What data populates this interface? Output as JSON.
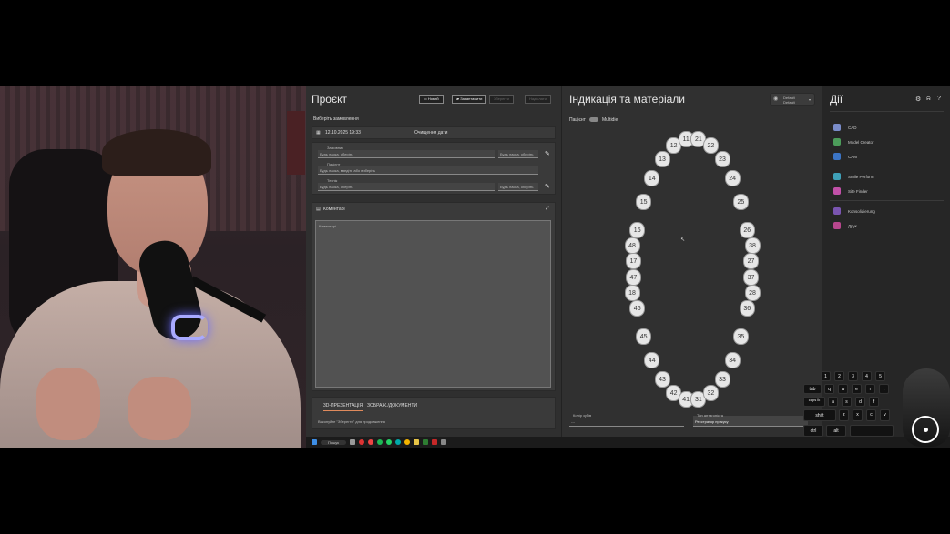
{
  "project": {
    "title": "Проєкт",
    "buttons": [
      "Новий",
      "Завантажити",
      "Зберегти",
      "Надіслати"
    ],
    "select_case": "Виберіть замовлення",
    "date": "12.10.2025 19:33",
    "clear_data": "Очищення дати",
    "fields": [
      {
        "label": "Замовник",
        "value": "Будь ласка, оберіть"
      },
      {
        "label": "Пацієнт",
        "value": "Будь ласка, введіть або виберіть"
      },
      {
        "label": "Технік",
        "value": "Будь ласка, оберіть"
      }
    ],
    "side_fields": [
      "Будь ласка, оберіть",
      "Будь ласка, оберіть"
    ],
    "comments_title": "Коментарі",
    "comments_placeholder": "Коментарі...",
    "tabs": [
      "3D-ПРЕЗЕНТАЦІЯ",
      "ЗОБРАЖ./ДОКУМЕНТИ"
    ],
    "status_line": "Виконуйте \"Зберегти\" для продовження"
  },
  "indication": {
    "title": "Індикація та матеріали",
    "profile": "Default",
    "profile_sub": "Default",
    "patient_label": "Пацієнт",
    "multidie_label": "Multidie",
    "teeth_upper": [
      "18",
      "17",
      "16",
      "15",
      "14",
      "13",
      "12",
      "11",
      "21",
      "22",
      "23",
      "24",
      "25",
      "26",
      "27",
      "28"
    ],
    "teeth_lower": [
      "48",
      "47",
      "46",
      "45",
      "44",
      "43",
      "42",
      "41",
      "31",
      "32",
      "33",
      "34",
      "35",
      "36",
      "37",
      "38"
    ],
    "bottom_left_label": "Колір зубів",
    "bottom_left_value": "---",
    "bottom_right_label": "Тип антагоніста",
    "bottom_right_value": "Реєстратор прикусу"
  },
  "actions": {
    "title": "Дії",
    "items": [
      {
        "label": "CAD",
        "color": "#7a8cc9"
      },
      {
        "label": "Model Creator",
        "color": "#4c9c5a"
      },
      {
        "label": "CAM",
        "color": "#3b74c4"
      },
      {
        "label": "Smile Perform",
        "color": "#3fa1b8"
      },
      {
        "label": "Site Finder",
        "color": "#c150a8"
      },
      {
        "label": "Konsolidierung",
        "color": "#7a55b0"
      },
      {
        "label": "Друк",
        "color": "#b8478e"
      }
    ]
  },
  "taskbar": {
    "search": "Пошук"
  },
  "keyboard": {
    "row1": [
      "1",
      "2",
      "3",
      "4",
      "5"
    ],
    "row2": [
      "tab",
      "q",
      "w",
      "e",
      "r",
      "t"
    ],
    "row3": [
      "caps lk",
      "a",
      "s",
      "d",
      "f"
    ],
    "row4": [
      "shift",
      "z",
      "x",
      "c",
      "v"
    ],
    "row5": [
      "ctrl",
      "alt"
    ]
  }
}
